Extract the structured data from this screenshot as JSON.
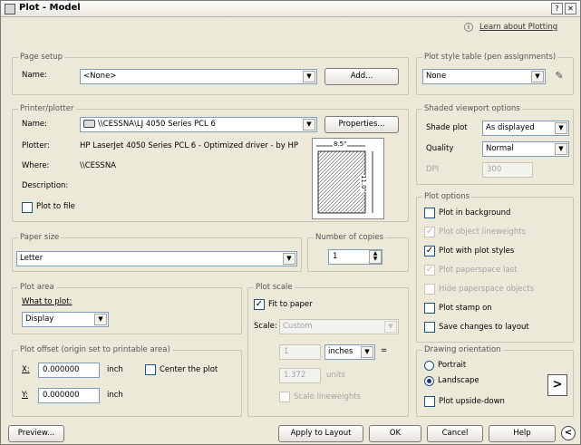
{
  "window": {
    "title": "Plot - Model",
    "help_link": "Learn about Plotting"
  },
  "page_setup": {
    "legend": "Page setup",
    "name_label": "Name:",
    "name_value": "<None>",
    "add_button": "Add..."
  },
  "printer": {
    "legend": "Printer/plotter",
    "name_label": "Name:",
    "name_value": "\\\\CESSNA\\LJ 4050 Series PCL 6",
    "properties_button": "Properties...",
    "plotter_label": "Plotter:",
    "plotter_value": "HP LaserJet 4050 Series PCL 6 - Optimized driver - by HP",
    "where_label": "Where:",
    "where_value": "\\\\CESSNA",
    "description_label": "Description:",
    "plot_to_file": "Plot to file",
    "preview_width": "8.5\"",
    "preview_height": "11.0\""
  },
  "paper_size": {
    "legend": "Paper size",
    "value": "Letter"
  },
  "copies": {
    "legend": "Number of copies",
    "value": "1"
  },
  "plot_area": {
    "legend": "Plot area",
    "what_label": "What to plot:",
    "value": "Display"
  },
  "plot_offset": {
    "legend": "Plot offset (origin set to printable area)",
    "x_label": "X:",
    "x_value": "0.000000",
    "x_unit": "inch",
    "y_label": "Y:",
    "y_value": "0.000000",
    "y_unit": "inch",
    "center": "Center the plot"
  },
  "plot_scale": {
    "legend": "Plot scale",
    "fit": "Fit to paper",
    "scale_label": "Scale:",
    "scale_value": "Custom",
    "v1": "1",
    "unit1": "inches",
    "eq": "=",
    "v2": "1.372",
    "unit2": "units",
    "lineweights": "Scale lineweights"
  },
  "style_table": {
    "legend": "Plot style table (pen assignments)",
    "value": "None"
  },
  "shaded": {
    "legend": "Shaded viewport options",
    "shade_label": "Shade plot",
    "shade_value": "As displayed",
    "quality_label": "Quality",
    "quality_value": "Normal",
    "dpi_label": "DPI",
    "dpi_value": "300"
  },
  "plot_options": {
    "legend": "Plot options",
    "items": [
      {
        "label": "Plot in background",
        "checked": "",
        "enabled": true
      },
      {
        "label": "Plot object lineweights",
        "checked": "✓",
        "enabled": false
      },
      {
        "label": "Plot with plot styles",
        "checked": "✓",
        "enabled": true
      },
      {
        "label": "Plot paperspace last",
        "checked": "✓",
        "enabled": false
      },
      {
        "label": "Hide paperspace objects",
        "checked": "",
        "enabled": false
      },
      {
        "label": "Plot stamp on",
        "checked": "",
        "enabled": true
      },
      {
        "label": "Save changes to layout",
        "checked": "",
        "enabled": true
      }
    ]
  },
  "orientation": {
    "legend": "Drawing orientation",
    "portrait": "Portrait",
    "landscape": "Landscape",
    "upside": "Plot upside-down"
  },
  "footer": {
    "preview": "Preview...",
    "apply": "Apply to Layout",
    "ok": "OK",
    "cancel": "Cancel",
    "help": "Help"
  }
}
